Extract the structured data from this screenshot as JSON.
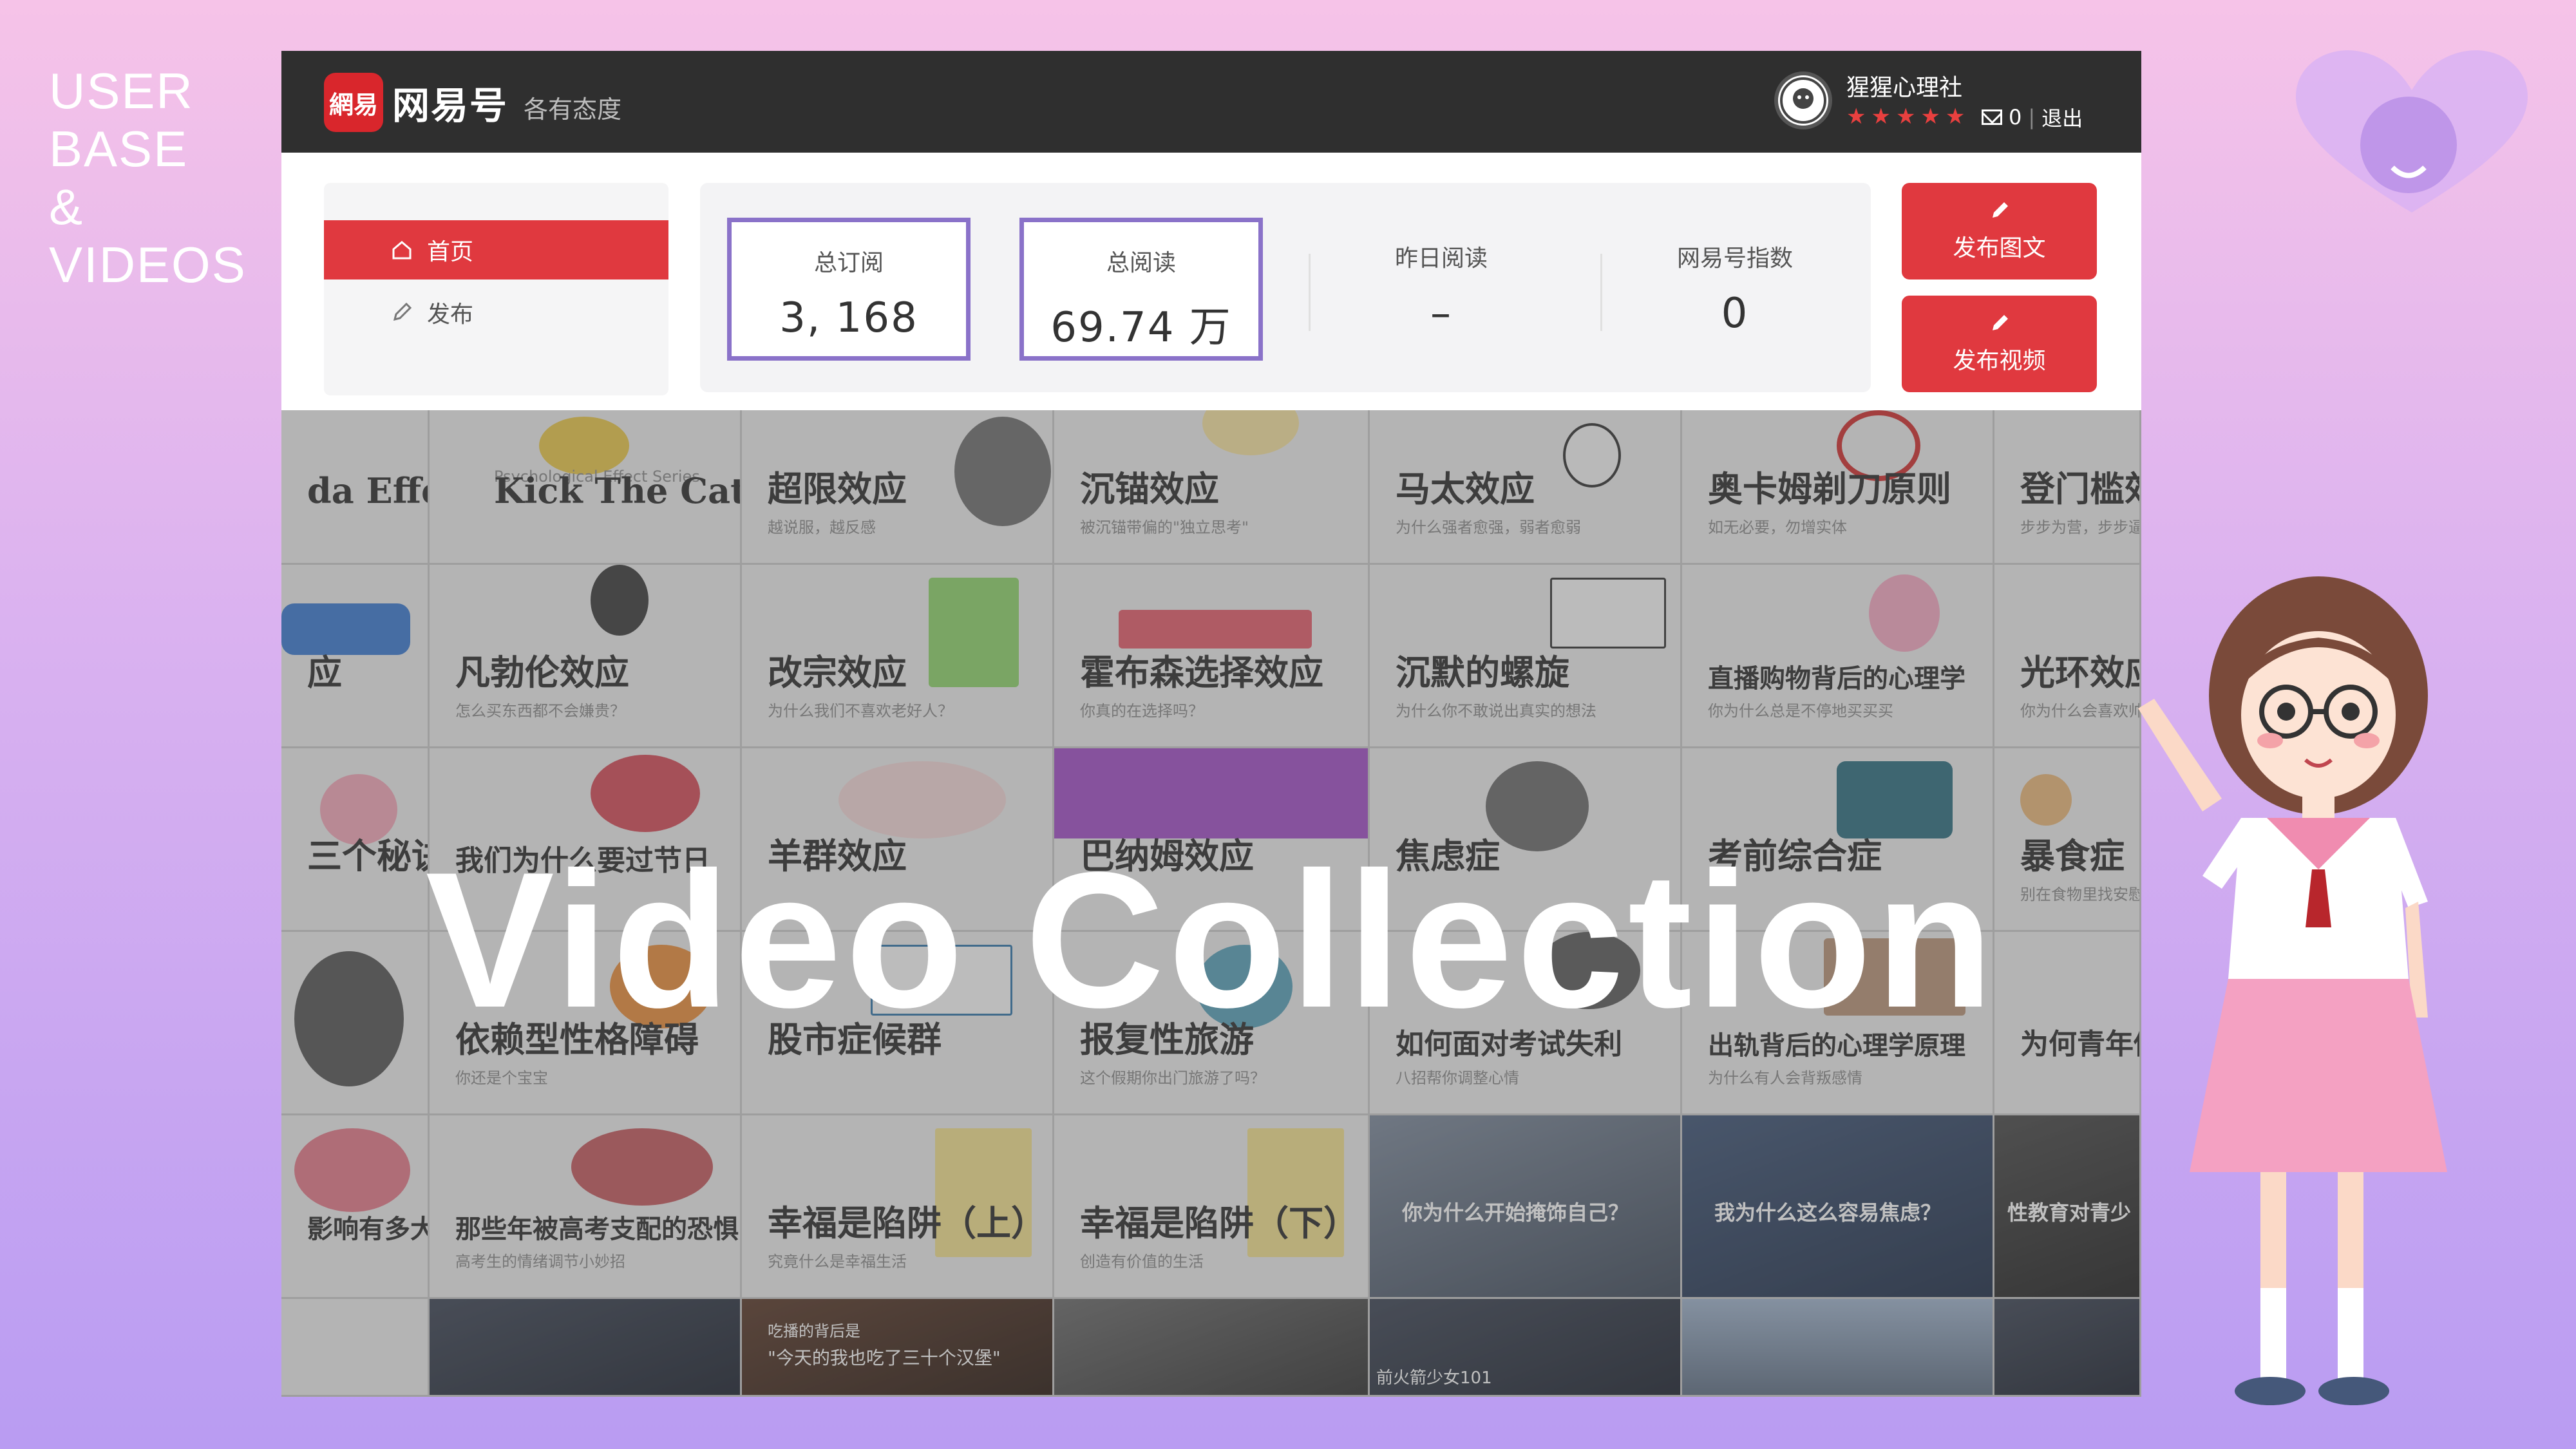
{
  "side_title": [
    "USER",
    "BASE",
    "&",
    "VIDEOS"
  ],
  "header": {
    "logo_badge": "網易",
    "logo_name": "网易号",
    "slogan": "各有态度",
    "user_name": "猩猩心理社",
    "stars": "★★★★★",
    "mail_count": "0",
    "separator": "|",
    "logout": "退出"
  },
  "menu": {
    "items": [
      {
        "label": "首页",
        "icon": "home-icon"
      },
      {
        "label": "发布",
        "icon": "pencil-icon"
      }
    ]
  },
  "stats": [
    {
      "label": "总订阅",
      "value": "3, 168"
    },
    {
      "label": "总阅读",
      "value": "69.74 万"
    },
    {
      "label": "昨日阅读",
      "value": "–"
    },
    {
      "label": "网易号指数",
      "value": "0"
    }
  ],
  "actions": {
    "publish_article": "发布图文",
    "publish_video": "发布视频"
  },
  "tiles": [
    {
      "title": "da Effect",
      "sub": ""
    },
    {
      "title": "Kick The Cat",
      "sub": "Psychological Effect Series"
    },
    {
      "title": "超限效应",
      "sub": "越说服，越反感"
    },
    {
      "title": "沉锚效应",
      "sub": "被沉锚带偏的\"独立思考\""
    },
    {
      "title": "马太效应",
      "sub": "为什么强者愈强，弱者愈弱"
    },
    {
      "title": "奥卡姆剃刀原则",
      "sub": "如无必要，勿增实体"
    },
    {
      "title": "登门槛效应",
      "sub": "步步为营，步步逼近"
    },
    {
      "title": "应",
      "sub": ""
    },
    {
      "title": "凡勃伦效应",
      "sub": "怎么买东西都不会嫌贵？"
    },
    {
      "title": "改宗效应",
      "sub": "为什么我们不喜欢老好人？"
    },
    {
      "title": "霍布森选择效应",
      "sub": "你真的在选择吗？"
    },
    {
      "title": "沉默的螺旋",
      "sub": "为什么你不敢说出真实的想法"
    },
    {
      "title": "直播购物背后的心理学",
      "sub": "你为什么总是不停地买买买"
    },
    {
      "title": "光环效应",
      "sub": "你为什么会喜欢帅哥美女"
    },
    {
      "title": "三个秘诀",
      "sub": ""
    },
    {
      "title": "我们为什么要过节日",
      "sub": ""
    },
    {
      "title": "羊群效应",
      "sub": ""
    },
    {
      "title": "巴纳姆效应",
      "sub": ""
    },
    {
      "title": "焦虑症",
      "sub": ""
    },
    {
      "title": "考前综合症",
      "sub": ""
    },
    {
      "title": "暴食症",
      "sub": "别在食物里找安慰"
    },
    {
      "title": "",
      "sub": ""
    },
    {
      "title": "依赖型性格障碍",
      "sub": "你还是个宝宝"
    },
    {
      "title": "股市症候群",
      "sub": ""
    },
    {
      "title": "报复性旅游",
      "sub": "这个假期你出门旅游了吗？"
    },
    {
      "title": "如何面对考试失利",
      "sub": "八招帮你调整心情"
    },
    {
      "title": "出轨背后的心理学原理",
      "sub": "为什么有人会背叛感情"
    },
    {
      "title": "为何青年做高风险",
      "sub": ""
    },
    {
      "title": "影响有多大？",
      "sub": ""
    },
    {
      "title": "那些年被高考支配的恐惧",
      "sub": "高考生的情绪调节小妙招"
    },
    {
      "title": "幸福是陷阱（上）",
      "sub": "究竟什么是幸福生活"
    },
    {
      "title": "幸福是陷阱（下）",
      "sub": "创造有价值的生活"
    },
    {
      "title": "你为什么开始掩饰自己？",
      "sub": ""
    },
    {
      "title": "我为什么这么容易焦虑？",
      "sub": ""
    },
    {
      "title": "性教育对青少",
      "sub": ""
    }
  ],
  "photo_row_text": [
    "吃播的背后是",
    "\"今天的我也吃了三十个汉堡\"",
    "前火箭少女101"
  ],
  "overlay_title": "Video Collection",
  "colors": {
    "accent_red": "#e0393f",
    "stat_border": "#8a72c9",
    "topbar": "#2f2f2f"
  }
}
